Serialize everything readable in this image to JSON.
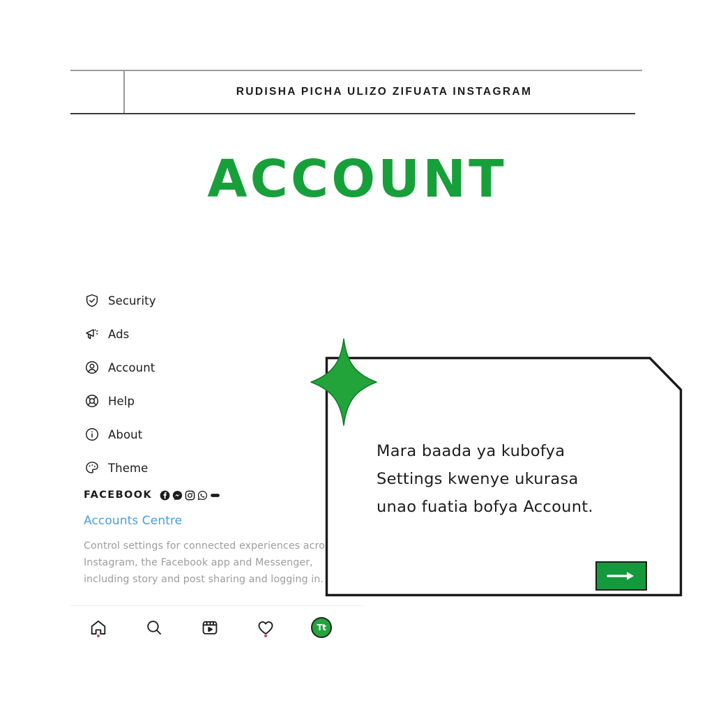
{
  "header": {
    "title": "RUDISHA PICHA ULIZO ZIFUATA INSTAGRAM",
    "left_cell": ""
  },
  "page_title": "ACCOUNT",
  "colors": {
    "brand_green": "#17a03a",
    "sparkle_green": "#23a43b",
    "button_green": "#149a3d",
    "link_blue": "#4a9ee0",
    "muted_gray": "#9d9d9d",
    "notification_dot": "#d04a5c"
  },
  "instagram_settings": {
    "menu": [
      {
        "icon": "shield-check-icon",
        "label": "Security"
      },
      {
        "icon": "megaphone-icon",
        "label": "Ads"
      },
      {
        "icon": "person-circle-icon",
        "label": "Account"
      },
      {
        "icon": "life-ring-icon",
        "label": "Help"
      },
      {
        "icon": "info-circle-icon",
        "label": "About"
      },
      {
        "icon": "palette-icon",
        "label": "Theme"
      }
    ],
    "facebook_section": {
      "heading": "FACEBOOK",
      "brand_icons": [
        "facebook-icon",
        "messenger-icon",
        "instagram-icon",
        "whatsapp-icon",
        "portal-icon"
      ],
      "link": "Accounts Centre",
      "description": "Control settings for connected experiences across Instagram, the Facebook app and Messenger, including story and post sharing and logging in."
    },
    "tabbar": [
      {
        "icon": "home-icon",
        "label": "Home",
        "badge": true
      },
      {
        "icon": "search-icon",
        "label": "Search",
        "badge": false
      },
      {
        "icon": "reels-icon",
        "label": "Reels",
        "badge": false
      },
      {
        "icon": "heart-icon",
        "label": "Activity",
        "badge": true
      },
      {
        "icon": "avatar-icon",
        "label": "Tt",
        "badge": false
      }
    ]
  },
  "callout": {
    "line1": "Mara baada ya kubofya",
    "line2": "Settings kwenye ukurasa",
    "line3": "unao fuatia bofya Account.",
    "next_label": "next-arrow"
  }
}
